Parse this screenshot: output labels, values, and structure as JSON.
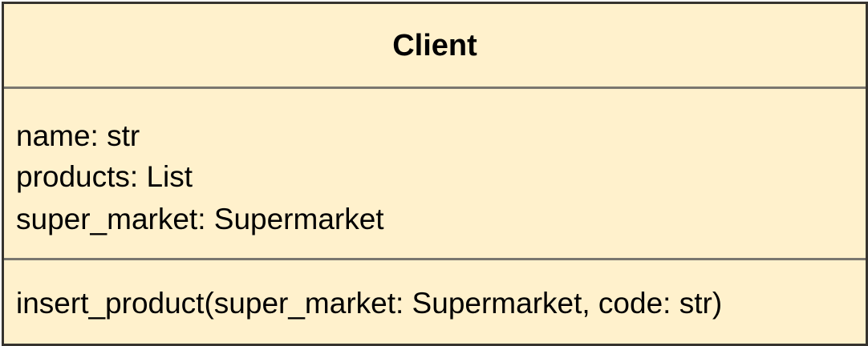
{
  "class": {
    "name": "Client",
    "attributes": [
      "name: str",
      "products: List",
      "super_market: Supermarket"
    ],
    "operations": [
      "insert_product(super_market: Supermarket, code: str)"
    ]
  },
  "colors": {
    "fill": "#fff1cc",
    "border": "#36332e",
    "divider": "#7a776f",
    "text": "#000000"
  }
}
